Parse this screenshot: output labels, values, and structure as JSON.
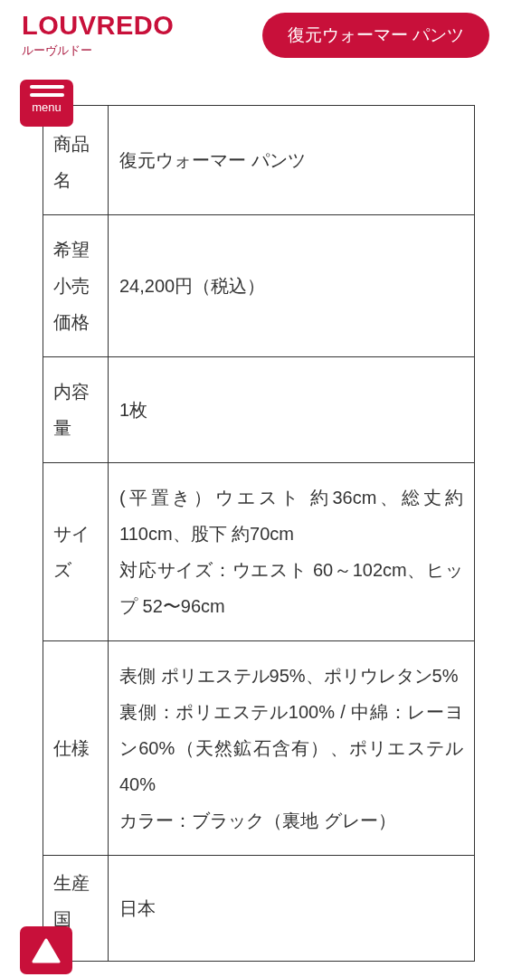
{
  "header": {
    "logo": "LOUVREDO",
    "logo_sub": "ルーヴルドー",
    "product_button": "復元ウォーマー パンツ"
  },
  "menu_button": {
    "label": "menu"
  },
  "spec_table": {
    "rows": [
      {
        "label": "商品名",
        "value": [
          "復元ウォーマー パンツ"
        ]
      },
      {
        "label": "希望小売価格",
        "value": [
          "24,200円（税込）"
        ]
      },
      {
        "label": "内容量",
        "value": [
          "1枚"
        ]
      },
      {
        "label": "サイズ",
        "value": [
          "(平置き）ウエスト 約36cm、総丈約110cm、股下 約70cm",
          "対応サイズ：ウエスト 60～102cm、ヒップ 52〜96cm"
        ]
      },
      {
        "label": "仕様",
        "value": [
          "表側 ポリエステル95%、ポリウレタン5%",
          "裏側：ポリエステル100% / 中綿：レーヨン60%（天然鉱石含有）、ポリエステル40%",
          "カラー：ブラック（裏地 グレー）"
        ]
      },
      {
        "label": "生産国",
        "value": [
          "日本"
        ]
      }
    ]
  }
}
